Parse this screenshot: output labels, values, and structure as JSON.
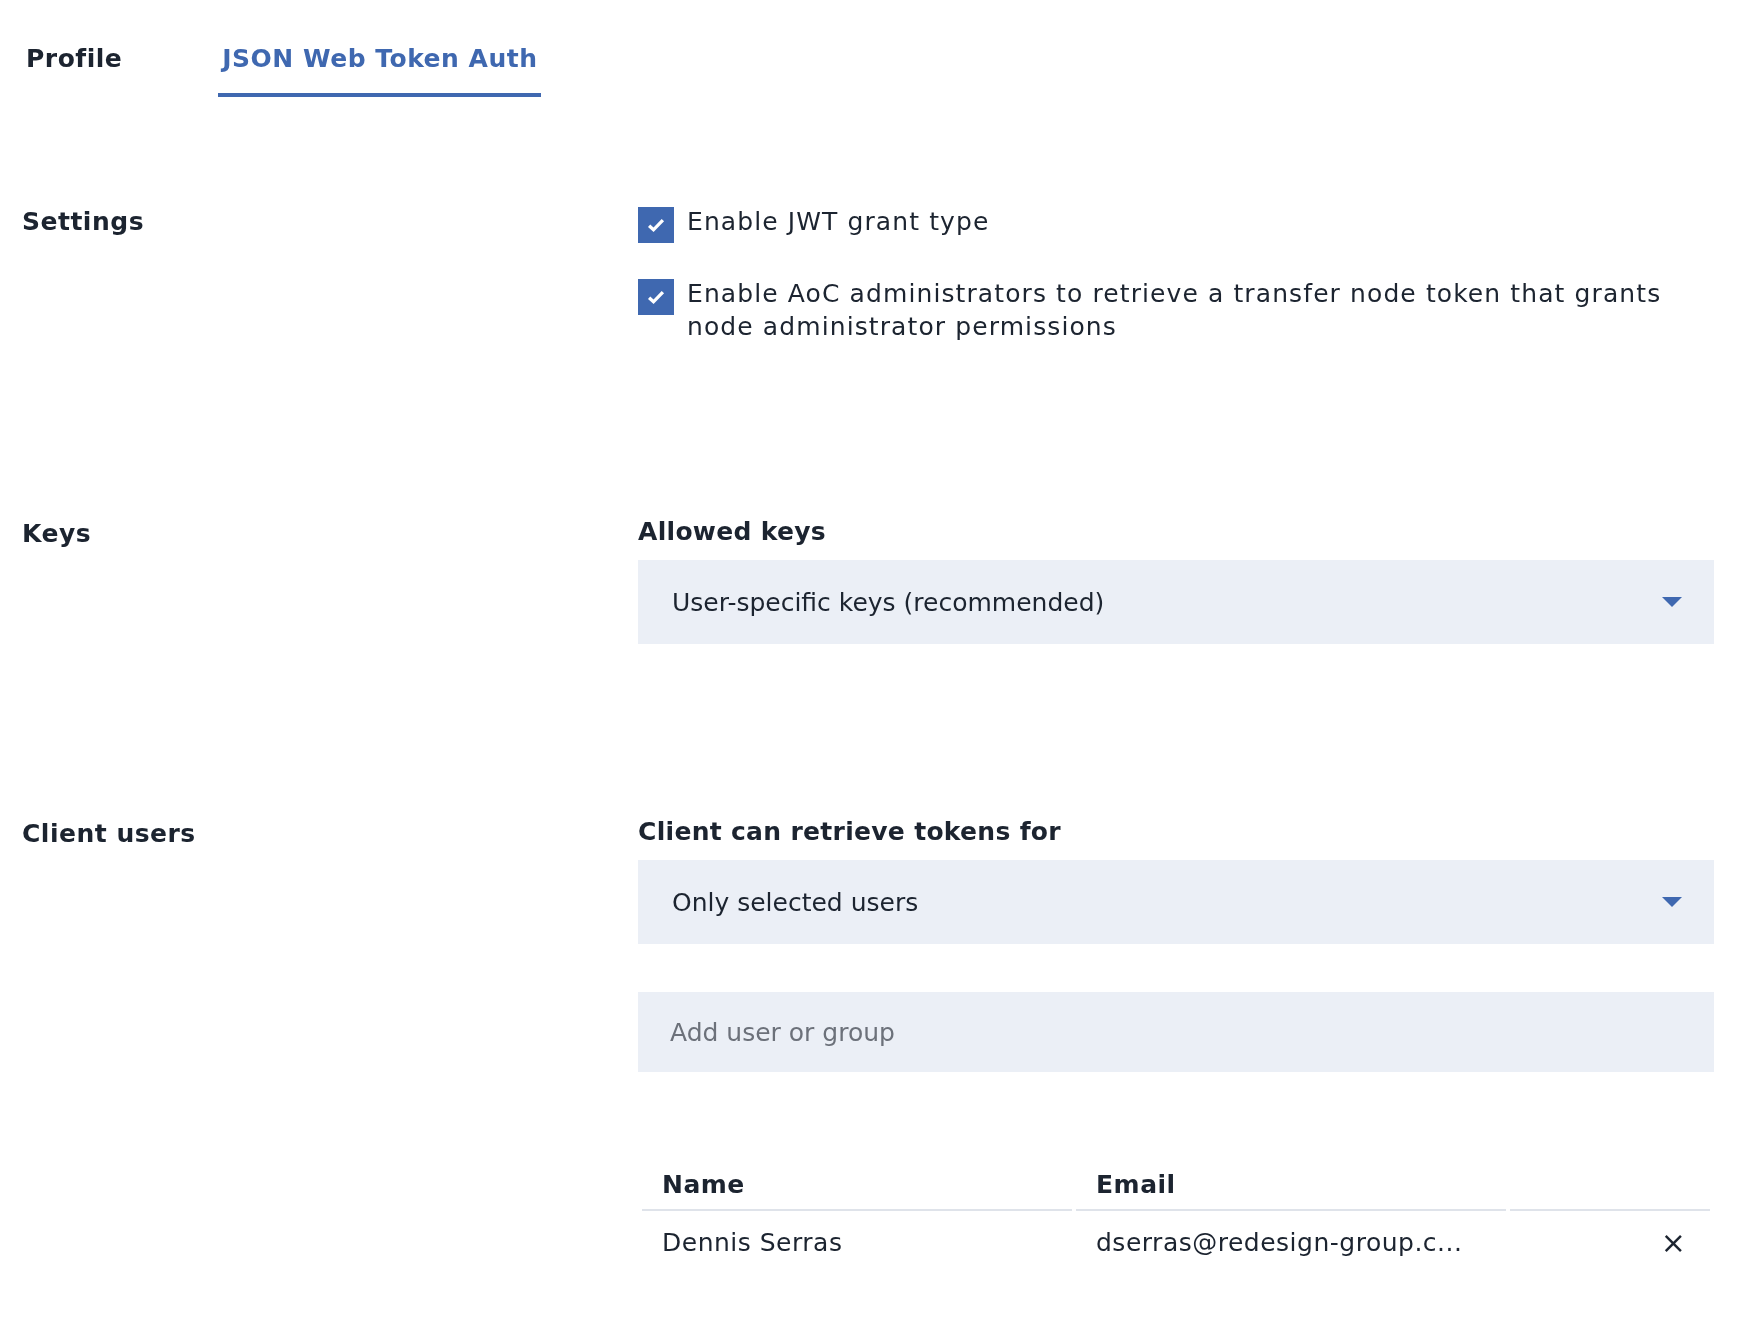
{
  "tabs": [
    {
      "label": "Profile",
      "selected": false
    },
    {
      "label": "JSON Web Token Auth",
      "selected": true
    }
  ],
  "sections": [
    {
      "title": "Settings",
      "kind": "checkboxes",
      "checkboxes": [
        {
          "label": "Enable JWT grant type",
          "checked": true
        },
        {
          "label": "Enable AoC administrators to retrieve a transfer node token that grants node administrator permissions",
          "checked": true
        }
      ]
    },
    {
      "title": "Keys",
      "kind": "select",
      "field_label": "Allowed keys",
      "value": "User-specific keys (recommended)"
    },
    {
      "title": "Client users",
      "kind": "users",
      "field_label": "Client can retrieve tokens for",
      "value": "Only selected users",
      "search": {
        "placeholder": "Add user or group"
      },
      "table": {
        "columns": [
          "Name",
          "Email"
        ],
        "rows": [
          {
            "name": "Dennis Serras",
            "email": "dserras@redesign-group.c...",
            "remove": "×"
          }
        ]
      }
    }
  ]
}
